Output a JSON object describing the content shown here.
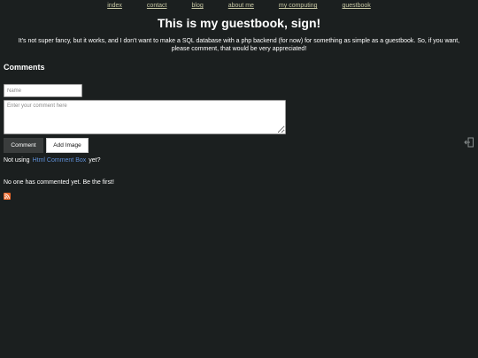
{
  "nav": {
    "items": [
      {
        "label": "index"
      },
      {
        "label": "contact"
      },
      {
        "label": "blog"
      },
      {
        "label": "about me"
      },
      {
        "label": "my computing"
      },
      {
        "label": "guestbook"
      }
    ]
  },
  "header": {
    "title": "This is my guestbook, sign!",
    "intro": "It's not super fancy, but it works, and I don't want to make a SQL database with a php backend (for now) for something as simple as a guestbook. So, if you want, please comment, that would be very appreciated!"
  },
  "comments": {
    "heading": "Comments",
    "name_placeholder": "Name",
    "comment_placeholder": "Enter your comment here",
    "comment_button": "Comment",
    "add_image_button": "Add Image",
    "not_using_prefix": "Not using",
    "not_using_link": "Html Comment Box",
    "not_using_suffix": "yet?",
    "empty_message": "No one has commented yet. Be the first!"
  },
  "icons": {
    "rss": "rss-feed-icon",
    "side": "logout-icon"
  },
  "colors": {
    "background": "#1b1f1f",
    "nav_link": "#c7c7a3",
    "link": "#5f8fd6",
    "rss": "#e8672b"
  }
}
